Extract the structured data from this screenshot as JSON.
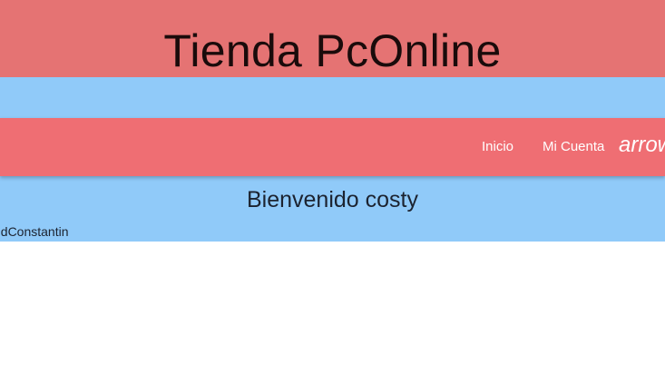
{
  "header": {
    "title": "Tienda PcOnline"
  },
  "nav": {
    "items": [
      {
        "label": "Inicio"
      },
      {
        "label": "Mi Cuenta"
      }
    ],
    "overflow_text": "arrow"
  },
  "main": {
    "welcome": "Bienvenido costy",
    "user_fragment": "ndConstantin"
  },
  "colors": {
    "header_bg": "#e57373",
    "band_bg": "#90caf9",
    "navbar_bg": "#ef6e73"
  }
}
